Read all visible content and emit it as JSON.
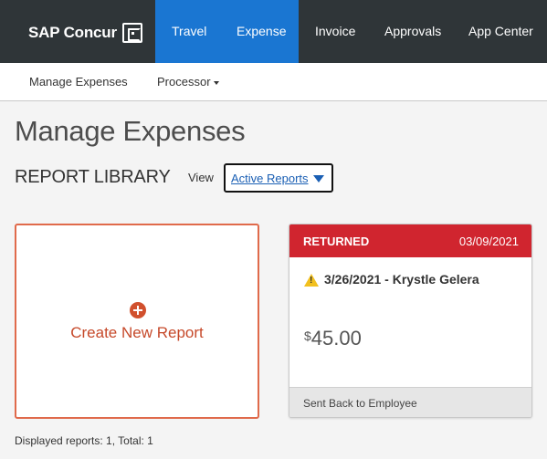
{
  "header": {
    "logo_text": "SAP Concur",
    "nav": [
      {
        "label": "Travel"
      },
      {
        "label": "Expense"
      },
      {
        "label": "Invoice"
      },
      {
        "label": "Approvals"
      },
      {
        "label": "App Center"
      }
    ],
    "active_nav_color": "#1a76d2"
  },
  "subnav": {
    "items": [
      {
        "label": "Manage Expenses"
      },
      {
        "label": "Processor"
      }
    ]
  },
  "page": {
    "title": "Manage Expenses",
    "library_title": "REPORT LIBRARY",
    "view_label": "View",
    "view_value": "Active Reports"
  },
  "create_card": {
    "label": "Create New Report",
    "icon": "plus-circle-icon"
  },
  "reports": [
    {
      "status": "RETURNED",
      "date": "03/09/2021",
      "name": "3/26/2021 - Krystle Gelera",
      "currency_symbol": "$",
      "amount": "45.00",
      "footer": "Sent Back to Employee",
      "status_color": "#d0252f",
      "icon": "warning-icon"
    }
  ],
  "footer": {
    "count_text": "Displayed reports: 1, Total: 1"
  }
}
